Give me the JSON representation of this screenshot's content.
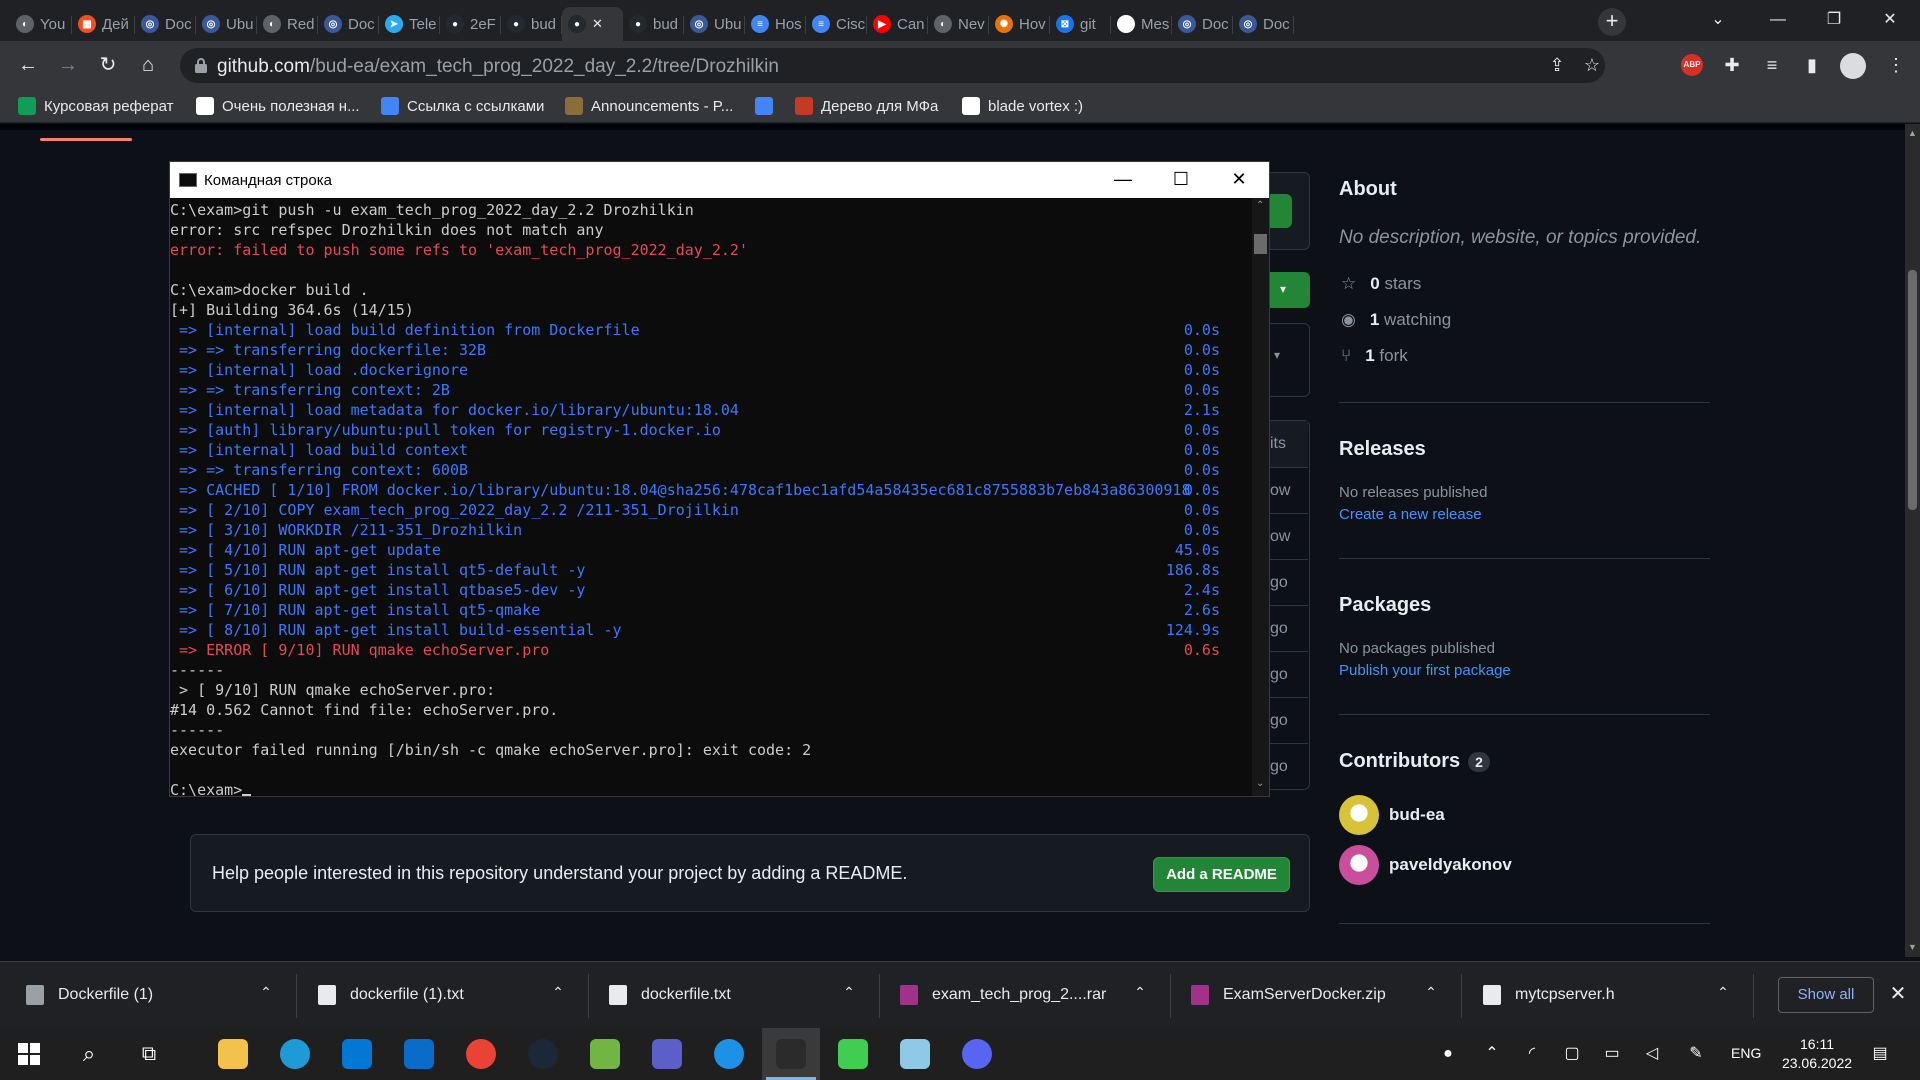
{
  "browser": {
    "tabs": [
      {
        "label": "You",
        "color": "#5f6368",
        "glyph": "◐"
      },
      {
        "label": "Дей",
        "color": "#f25022",
        "glyph": "▦"
      },
      {
        "label": "Doc",
        "color": "#3b5998",
        "glyph": "◎"
      },
      {
        "label": "Ubu",
        "color": "#3b5998",
        "glyph": "◎"
      },
      {
        "label": "Red",
        "color": "#5f6368",
        "glyph": "◐"
      },
      {
        "label": "Doc",
        "color": "#3b5998",
        "glyph": "◎"
      },
      {
        "label": "Tele",
        "color": "#2aabee",
        "glyph": "➤"
      },
      {
        "label": "2eF",
        "color": "#24292f",
        "glyph": "●"
      },
      {
        "label": "bud",
        "color": "#24292f",
        "glyph": "●"
      },
      {
        "label": "",
        "color": "#24292f",
        "glyph": "●",
        "active": true
      },
      {
        "label": "bud",
        "color": "#24292f",
        "glyph": "●"
      },
      {
        "label": "Ubu",
        "color": "#3b5998",
        "glyph": "◎"
      },
      {
        "label": "Hos",
        "color": "#4285f4",
        "glyph": "≡"
      },
      {
        "label": "Cisc",
        "color": "#4285f4",
        "glyph": "≡"
      },
      {
        "label": "Can",
        "color": "#ff0000",
        "glyph": "▶"
      },
      {
        "label": "Nev",
        "color": "#5f6368",
        "glyph": "◐"
      },
      {
        "label": "Hov",
        "color": "#e8710a",
        "glyph": "✺"
      },
      {
        "label": "git",
        "color": "#1a73e8",
        "glyph": "⊠"
      },
      {
        "label": "Mes",
        "color": "#ffffff",
        "glyph": "▣"
      },
      {
        "label": "Doc",
        "color": "#3b5998",
        "glyph": "◎"
      },
      {
        "label": "Doc",
        "color": "#3b5998",
        "glyph": "◎"
      }
    ],
    "new_tab": "+",
    "url_host": "github.com",
    "url_path": "/bud-ea/exam_tech_prog_2022_day_2.2/tree/Drozhilkin",
    "abp_badge": "ABP",
    "bookmarks": [
      {
        "label": "Курсовая реферат",
        "color": "#0f9d58"
      },
      {
        "label": "Очень полезная н...",
        "color": "#ffffff"
      },
      {
        "label": "Ссылка с ссылками",
        "color": "#4285f4"
      },
      {
        "label": "Announcements - P...",
        "color": "#8a6d3b"
      },
      {
        "label": "",
        "color": "#4285f4"
      },
      {
        "label": "Дерево для МФа",
        "color": "#c23b22"
      },
      {
        "label": "blade vortex :)",
        "color": "#ffffff"
      }
    ]
  },
  "github": {
    "about_title": "About",
    "about_desc": "No description, website, or topics provided.",
    "stars": "0",
    "stars_label": "stars",
    "watching": "1",
    "watching_label": "watching",
    "forks": "1",
    "forks_label": "fork",
    "releases_title": "Releases",
    "releases_none": "No releases published",
    "releases_link": "Create a new release",
    "packages_title": "Packages",
    "packages_none": "No packages published",
    "packages_link": "Publish your first package",
    "contributors_title": "Contributors",
    "contributors_count": "2",
    "contributors": [
      {
        "name": "bud-ea",
        "color": "#d8c23a"
      },
      {
        "name": "paveldyakonov",
        "color": "#c94f9c"
      }
    ],
    "file_rows": [
      "its",
      "ow",
      "ow",
      "go",
      "go",
      "go",
      "go",
      "go"
    ],
    "readme_text": "Help people interested in this repository understand your project by adding a README.",
    "readme_button": "Add a README"
  },
  "cmd": {
    "title": "Командная строка",
    "lines": [
      {
        "text": "C:\\exam>git push -u exam_tech_prog_2022_day_2.2 Drozhilkin",
        "color": "gray",
        "time": ""
      },
      {
        "text": "error: src refspec Drozhilkin does not match any",
        "color": "gray",
        "time": ""
      },
      {
        "text": "error: failed to push some refs to 'exam_tech_prog_2022_day_2.2'",
        "color": "red",
        "time": ""
      },
      {
        "text": "",
        "color": "gray",
        "time": ""
      },
      {
        "text": "C:\\exam>docker build .",
        "color": "gray",
        "time": ""
      },
      {
        "text": "[+] Building 364.6s (14/15)",
        "color": "gray",
        "time": ""
      },
      {
        "text": " => [internal] load build definition from Dockerfile",
        "color": "blue",
        "time": "0.0s"
      },
      {
        "text": " => => transferring dockerfile: 32B",
        "color": "blue",
        "time": "0.0s"
      },
      {
        "text": " => [internal] load .dockerignore",
        "color": "blue",
        "time": "0.0s"
      },
      {
        "text": " => => transferring context: 2B",
        "color": "blue",
        "time": "0.0s"
      },
      {
        "text": " => [internal] load metadata for docker.io/library/ubuntu:18.04",
        "color": "blue",
        "time": "2.1s"
      },
      {
        "text": " => [auth] library/ubuntu:pull token for registry-1.docker.io",
        "color": "blue",
        "time": "0.0s"
      },
      {
        "text": " => [internal] load build context",
        "color": "blue",
        "time": "0.0s"
      },
      {
        "text": " => => transferring context: 600B",
        "color": "blue",
        "time": "0.0s"
      },
      {
        "text": " => CACHED [ 1/10] FROM docker.io/library/ubuntu:18.04@sha256:478caf1bec1afd54a58435ec681c8755883b7eb843a86300918",
        "color": "blue",
        "time": "0.0s"
      },
      {
        "text": " => [ 2/10] COPY exam_tech_prog_2022_day_2.2 /211-351_Drojilkin",
        "color": "blue",
        "time": "0.0s"
      },
      {
        "text": " => [ 3/10] WORKDIR /211-351_Drozhilkin",
        "color": "blue",
        "time": "0.0s"
      },
      {
        "text": " => [ 4/10] RUN apt-get update",
        "color": "blue",
        "time": "45.0s"
      },
      {
        "text": " => [ 5/10] RUN apt-get install qt5-default -y",
        "color": "blue",
        "time": "186.8s"
      },
      {
        "text": " => [ 6/10] RUN apt-get install qtbase5-dev -y",
        "color": "blue",
        "time": "2.4s"
      },
      {
        "text": " => [ 7/10] RUN apt-get install qt5-qmake",
        "color": "blue",
        "time": "2.6s"
      },
      {
        "text": " => [ 8/10] RUN apt-get install build-essential -y",
        "color": "blue",
        "time": "124.9s"
      },
      {
        "text": " => ERROR [ 9/10] RUN qmake echoServer.pro",
        "color": "red",
        "time": "0.6s"
      },
      {
        "text": "------",
        "color": "gray",
        "time": ""
      },
      {
        "text": " > [ 9/10] RUN qmake echoServer.pro:",
        "color": "gray",
        "time": ""
      },
      {
        "text": "#14 0.562 Cannot find file: echoServer.pro.",
        "color": "gray",
        "time": ""
      },
      {
        "text": "------",
        "color": "gray",
        "time": ""
      },
      {
        "text": "executor failed running [/bin/sh -c qmake echoServer.pro]: exit code: 2",
        "color": "gray",
        "time": ""
      },
      {
        "text": "",
        "color": "gray",
        "time": ""
      },
      {
        "text": "C:\\exam>",
        "color": "gray",
        "time": "",
        "cursor": true
      }
    ]
  },
  "downloads": {
    "items": [
      {
        "label": "Dockerfile (1)",
        "color": "#9aa0a6"
      },
      {
        "label": "dockerfile (1).txt",
        "color": "#e8eaed"
      },
      {
        "label": "dockerfile.txt",
        "color": "#e8eaed"
      },
      {
        "label": "exam_tech_prog_2....rar",
        "color": "#a0328c"
      },
      {
        "label": "ExamServerDocker.zip",
        "color": "#a0328c"
      },
      {
        "label": "mytcpserver.h",
        "color": "#e8eaed"
      }
    ],
    "show_all": "Show all"
  },
  "taskbar": {
    "apps": [
      {
        "name": "explorer",
        "color": "#f3c24b"
      },
      {
        "name": "edge",
        "color": "#1d9bd7"
      },
      {
        "name": "store",
        "color": "#0078d4"
      },
      {
        "name": "mail",
        "color": "#0a6cc9"
      },
      {
        "name": "chrome",
        "color": "#ea4335"
      },
      {
        "name": "steam",
        "color": "#1b2838"
      },
      {
        "name": "utorrent",
        "color": "#71b544"
      },
      {
        "name": "teams",
        "color": "#5b5fc7"
      },
      {
        "name": "docker",
        "color": "#1d91e6"
      },
      {
        "name": "cmd",
        "color": "#2b2b2b"
      },
      {
        "name": "qtcreator",
        "color": "#41cd52"
      },
      {
        "name": "notepad",
        "color": "#8ecae6"
      },
      {
        "name": "discord",
        "color": "#5865f2"
      }
    ],
    "lang": "ENG",
    "time": "16:11",
    "date": "23.06.2022"
  }
}
